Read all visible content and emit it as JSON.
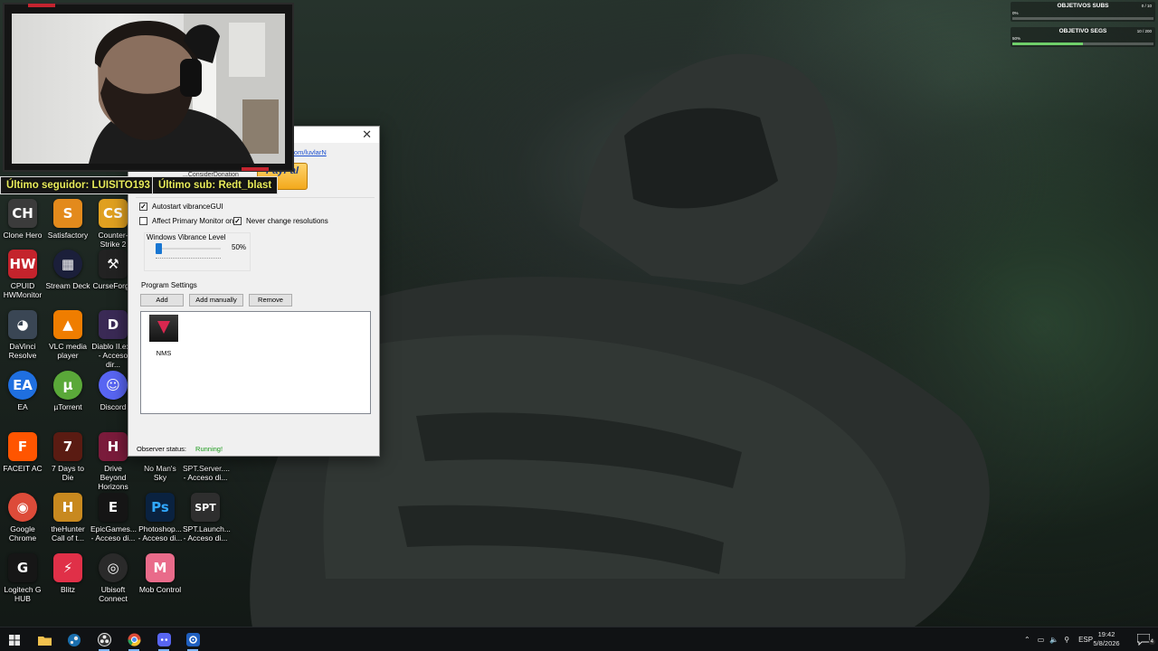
{
  "overlay": {
    "follower_banner": "Último seguidor: LUISITO193",
    "sub_banner": "Último sub: Redt_blast",
    "goals": [
      {
        "title": "OBJETIVOS SUBS",
        "count": "0 / 10",
        "percent": "0%",
        "progress": 0.0
      },
      {
        "title": "OBJETIVO SEGS",
        "count": "10 / 200",
        "percent": "50%",
        "progress": 0.5
      }
    ]
  },
  "app": {
    "link_text": "r.com/luvlarN",
    "paypal_label": "PayPal",
    "donation_text": "...ConsiderDonation",
    "autostart_label": "Autostart vibranceGUI",
    "affect_primary_label": "Affect Primary Monitor only",
    "never_change_label": "Never change resolutions",
    "vibrance_label": "Windows Vibrance Level",
    "vibrance_value": "50%",
    "vibrance_level": 0.0,
    "program_settings_label": "Program Settings",
    "add_label": "Add",
    "add_manually_label": "Add manually",
    "remove_label": "Remove",
    "programs": [
      {
        "name": "NMS"
      }
    ],
    "observer_label": "Observer status:",
    "observer_value": "Running!"
  },
  "desktop": {
    "icons": [
      {
        "label": "Clone Hero",
        "icon": "clone-hero-icon",
        "color": "#3b3b3b",
        "glyph": "CH"
      },
      {
        "label": "Satisfactory",
        "icon": "satisfactory-icon",
        "color": "#e38a1c",
        "glyph": "S"
      },
      {
        "label": "Counter-Strike 2",
        "icon": "counter-strike-icon",
        "color": "#e0a020",
        "glyph": "CS"
      },
      {
        "label": "CPUID HWMonitor",
        "icon": "hwmonitor-icon",
        "color": "#c4232c",
        "glyph": "HW"
      },
      {
        "label": "Stream Deck",
        "icon": "stream-deck-icon",
        "color": "#1b1f3a",
        "glyph": "▦"
      },
      {
        "label": "CurseForge",
        "icon": "curseforge-icon",
        "color": "#222222",
        "glyph": "⚒"
      },
      {
        "label": "DaVinci Resolve",
        "icon": "davinci-resolve-icon",
        "color": "#3a4654",
        "glyph": "◕"
      },
      {
        "label": "VLC media player",
        "icon": "vlc-icon",
        "color": "#ef7d00",
        "glyph": "▲"
      },
      {
        "label": "Diablo II.exe - Acceso dir...",
        "icon": "diablo-icon",
        "color": "#3a2a55",
        "glyph": "D"
      },
      {
        "label": "EA",
        "icon": "ea-icon",
        "color": "#1f6fe0",
        "glyph": "EA"
      },
      {
        "label": "µTorrent",
        "icon": "utorrent-icon",
        "color": "#5aa839",
        "glyph": "µ"
      },
      {
        "label": "Discord",
        "icon": "discord-icon",
        "color": "#5865f2",
        "glyph": "☺"
      },
      {
        "label": "FACEIT AC",
        "icon": "faceit-icon",
        "color": "#ff5500",
        "glyph": "F"
      },
      {
        "label": "7 Days to Die",
        "icon": "seven-days-icon",
        "color": "#5a1b12",
        "glyph": "7"
      },
      {
        "label": "Drive Beyond Horizons",
        "icon": "drive-beyond-icon",
        "color": "#7a1b3b",
        "glyph": "H"
      },
      {
        "label": "No Man's Sky",
        "icon": "no-mans-sky-icon",
        "color": "#1d1d1d",
        "glyph": "▼"
      },
      {
        "label": "SPT.Server.... - Acceso di...",
        "icon": "spt-server-icon",
        "color": "#2b2b2b",
        "glyph": "S"
      },
      {
        "label": "Google Chrome",
        "icon": "chrome-icon",
        "color": "#dd4b39",
        "glyph": "◉"
      },
      {
        "label": "theHunter Call of t...",
        "icon": "thehunter-icon",
        "color": "#c8891f",
        "glyph": "H"
      },
      {
        "label": "EpicGames... - Acceso di...",
        "icon": "epic-games-icon",
        "color": "#151515",
        "glyph": "E"
      },
      {
        "label": "Photoshop... - Acceso di...",
        "icon": "photoshop-icon",
        "color": "#0a2240",
        "glyph": "Ps"
      },
      {
        "label": "SPT.Launch... - Acceso di...",
        "icon": "spt-launcher-icon",
        "color": "#2e2e2e",
        "glyph": "SPT"
      },
      {
        "label": "Logitech G HUB",
        "icon": "logitech-ghub-icon",
        "color": "#161616",
        "glyph": "G"
      },
      {
        "label": "Blitz",
        "icon": "blitz-icon",
        "color": "#e03048",
        "glyph": "⚡"
      },
      {
        "label": "Ubisoft Connect",
        "icon": "ubisoft-icon",
        "color": "#2a2a2a",
        "glyph": "◎"
      },
      {
        "label": "Mob Control",
        "icon": "mob-control-icon",
        "color": "#e96b8a",
        "glyph": "M"
      }
    ]
  },
  "taskbar": {
    "apps": [
      "start-icon",
      "file-explorer-icon",
      "steam-icon",
      "obs-icon",
      "chrome-icon",
      "discord-icon",
      "settings-icon"
    ],
    "language": "ESP",
    "time": "19:42",
    "date": "5/8/2026",
    "notification_count": "4"
  }
}
